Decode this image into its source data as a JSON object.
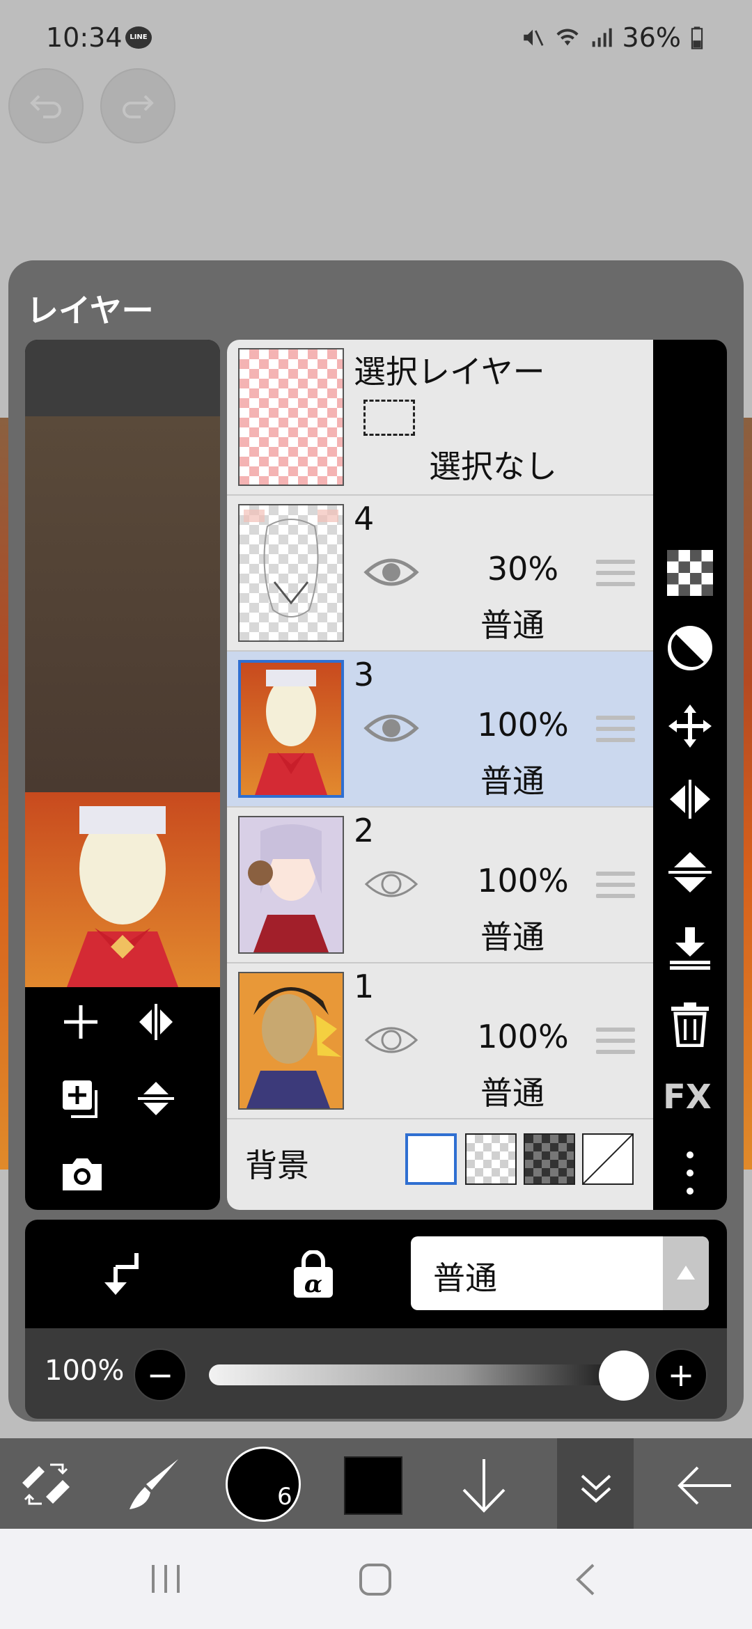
{
  "status_bar": {
    "time": "10:34",
    "battery": "36%",
    "line_badge": "LINE"
  },
  "panel": {
    "title": "レイヤー"
  },
  "layers": [
    {
      "id": "selection",
      "name": "選択レイヤー",
      "subtitle": "選択なし"
    },
    {
      "id": "4",
      "number": "4",
      "opacity": "30%",
      "mode": "普通",
      "visible": true,
      "selected": false
    },
    {
      "id": "3",
      "number": "3",
      "opacity": "100%",
      "mode": "普通",
      "visible": true,
      "selected": true
    },
    {
      "id": "2",
      "number": "2",
      "opacity": "100%",
      "mode": "普通",
      "visible": false,
      "selected": false
    },
    {
      "id": "1",
      "number": "1",
      "opacity": "100%",
      "mode": "普通",
      "visible": false,
      "selected": false
    }
  ],
  "background": {
    "label": "背景"
  },
  "blend_mode": {
    "value": "普通"
  },
  "opacity_slider": {
    "label": "100%",
    "value_fraction": 1.0
  },
  "sidebar_tools": [
    "checker-icon",
    "contrast-icon",
    "move-icon",
    "flip-h-icon",
    "flip-v-icon",
    "merge-down-icon",
    "trash-icon",
    "fx-icon",
    "more-icon"
  ],
  "sidebar_fx_label": "FX",
  "brush_size": "6",
  "colors": {
    "accent_blue": "#2f6fd1",
    "selected_row": "#cbd8ee",
    "panel_bg": "#6a6a6a"
  }
}
